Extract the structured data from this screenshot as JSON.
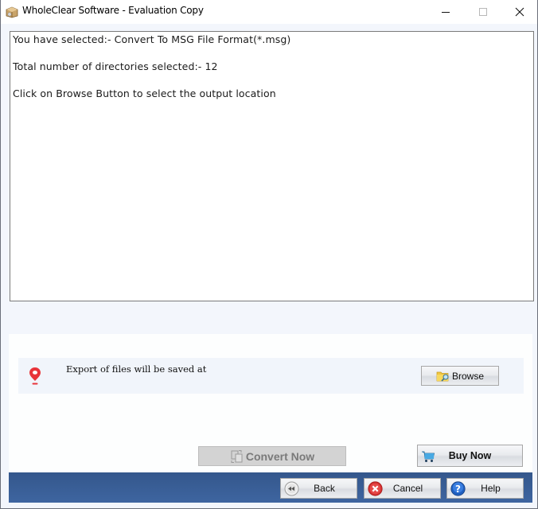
{
  "window": {
    "title": "WholeClear Software - Evaluation Copy",
    "icon": "app-box-icon",
    "controls": {
      "minimize": "minimize-icon",
      "maximize": "maximize-icon",
      "close": "close-icon"
    }
  },
  "log": {
    "lines": [
      "You have selected:- Convert To MSG File Format(*.msg)",
      "Total number of directories selected:- 12",
      "Click on Browse Button to select the output location"
    ]
  },
  "export": {
    "icon": "location-pin-icon",
    "label": "Export of files will be saved at",
    "browse_label": "Browse",
    "browse_icon": "folder-search-icon",
    "pin_color": "#e8343a"
  },
  "actions": {
    "convert_label": "Convert Now",
    "convert_icon": "convert-files-icon",
    "convert_enabled": false,
    "buy_label": "Buy Now",
    "buy_icon": "shopping-cart-icon"
  },
  "nav": {
    "back_label": "Back",
    "back_icon": "rewind-icon",
    "cancel_label": "Cancel",
    "cancel_icon": "cancel-x-icon",
    "help_label": "Help",
    "help_icon": "help-question-icon",
    "bar_color": "#3a5f98"
  }
}
